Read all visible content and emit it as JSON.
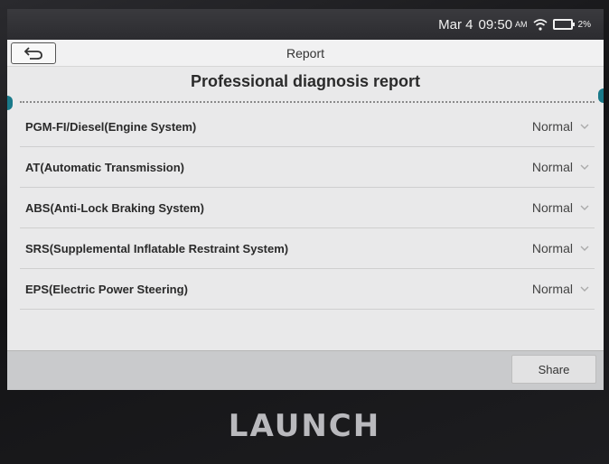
{
  "status_bar": {
    "date": "Mar 4",
    "time": "09:50",
    "ampm": "AM",
    "battery": "2%"
  },
  "title_bar": {
    "title": "Report"
  },
  "report": {
    "heading": "Professional diagnosis report",
    "systems": [
      {
        "name": "PGM-FI/Diesel(Engine System)",
        "status": "Normal"
      },
      {
        "name": "AT(Automatic Transmission)",
        "status": "Normal"
      },
      {
        "name": "ABS(Anti-Lock Braking System)",
        "status": "Normal"
      },
      {
        "name": "SRS(Supplemental Inflatable Restraint System)",
        "status": "Normal"
      },
      {
        "name": "EPS(Electric Power Steering)",
        "status": "Normal"
      }
    ]
  },
  "bottom_bar": {
    "share_label": "Share"
  },
  "device": {
    "brand": "LAUNCH"
  },
  "colors": {
    "accent": "#1a7a8a"
  },
  "icons": [
    "back-arrow-icon",
    "wifi-icon",
    "battery-icon",
    "chevron-down-icon"
  ]
}
